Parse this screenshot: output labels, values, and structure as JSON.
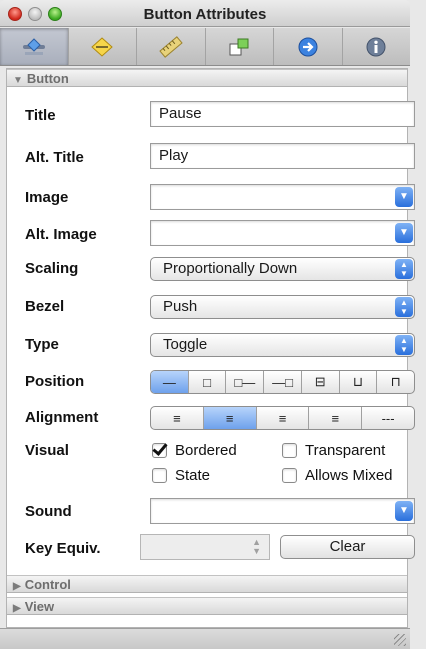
{
  "window": {
    "title": "Button Attributes"
  },
  "toolbar": {
    "tabs": [
      {
        "icon": "attributes-slider-icon",
        "active": true
      },
      {
        "icon": "diamond-effects-icon",
        "active": false
      },
      {
        "icon": "ruler-size-icon",
        "active": false
      },
      {
        "icon": "connections-icon",
        "active": false
      },
      {
        "icon": "bindings-arrow-icon",
        "active": false
      },
      {
        "icon": "info-icon",
        "active": false
      }
    ]
  },
  "sections": {
    "button": "Button",
    "control": "Control",
    "view": "View"
  },
  "labels": {
    "title": "Title",
    "alt_title": "Alt. Title",
    "image": "Image",
    "alt_image": "Alt. Image",
    "scaling": "Scaling",
    "bezel": "Bezel",
    "type": "Type",
    "position": "Position",
    "alignment": "Alignment",
    "visual": "Visual",
    "sound": "Sound",
    "key_equiv": "Key Equiv."
  },
  "values": {
    "title": "Pause",
    "alt_title": "Play",
    "image": "",
    "alt_image": "",
    "scaling": "Proportionally Down",
    "bezel": "Push",
    "type": "Toggle",
    "sound": "",
    "key_equiv": ""
  },
  "visual_options": {
    "bordered": {
      "label": "Bordered",
      "checked": true
    },
    "transparent": {
      "label": "Transparent",
      "checked": false
    },
    "state": {
      "label": "State",
      "checked": false
    },
    "allows_mixed": {
      "label": "Allows Mixed",
      "checked": false
    }
  },
  "position_segments": {
    "selected_index": 0,
    "glyphs": [
      "—",
      "□",
      "□—",
      "—□",
      "⊟",
      "⊔",
      "⊓"
    ]
  },
  "alignment_segments": {
    "selected_index": 1,
    "glyphs": [
      "≡",
      "≡",
      "≡",
      "≡",
      "---"
    ]
  },
  "buttons": {
    "clear": "Clear"
  },
  "colors": {
    "accent": "#2a6fdc",
    "selected_segment": "#6ea1ec"
  }
}
